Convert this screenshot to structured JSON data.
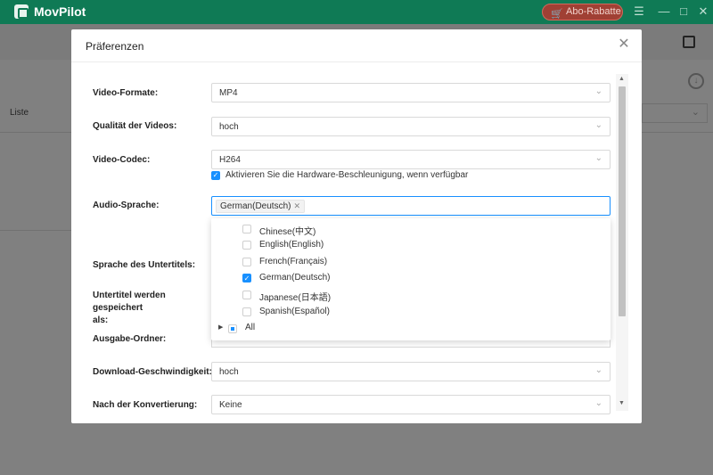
{
  "app": {
    "name": "MovPilot",
    "promo_label": "Abo-Rabatte"
  },
  "background": {
    "list_label": "Liste"
  },
  "dialog": {
    "title": "Präferenzen",
    "video_format": {
      "label": "Video-Formate:",
      "value": "MP4"
    },
    "video_quality": {
      "label": "Qualität der Videos:",
      "value": "hoch"
    },
    "video_codec": {
      "label": "Video-Codec:",
      "value": "H264"
    },
    "hardware_accel": {
      "label": "Aktivieren Sie die Hardware-Beschleunigung, wenn verfügbar",
      "checked": true
    },
    "audio_language": {
      "label": "Audio-Sprache:",
      "selected_tag": "German(Deutsch)"
    },
    "audio_options": [
      {
        "label": "Chinese(中文)",
        "checked": false
      },
      {
        "label": "English(English)",
        "checked": false
      },
      {
        "label": "French(Français)",
        "checked": false
      },
      {
        "label": "German(Deutsch)",
        "checked": true
      },
      {
        "label": "Japanese(日本語)",
        "checked": false
      },
      {
        "label": "Spanish(Español)",
        "checked": false
      }
    ],
    "all_option": {
      "label": "All",
      "state": "indeterminate"
    },
    "subtitle_language": {
      "label": "Sprache des Untertitels:"
    },
    "subtitle_save": {
      "label_line1": "Untertitel werden gespeichert",
      "label_line2": "als:"
    },
    "output_folder": {
      "label": "Ausgabe-Ordner:"
    },
    "download_speed": {
      "label": "Download-Geschwindigkeit:",
      "value": "hoch"
    },
    "after_conversion": {
      "label": "Nach der Konvertierung:",
      "value": "Keine"
    }
  },
  "colors": {
    "titlebar": "#0f7a55",
    "accent": "#1890ff",
    "promo": "#a04034"
  }
}
